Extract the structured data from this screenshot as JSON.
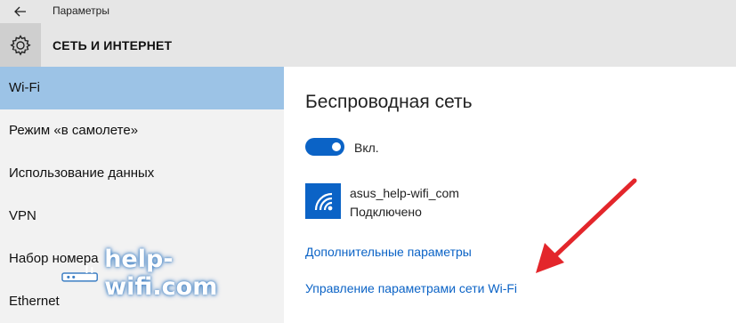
{
  "window": {
    "title": "Параметры"
  },
  "header": {
    "title": "СЕТЬ И ИНТЕРНЕТ"
  },
  "sidebar": {
    "items": [
      {
        "label": "Wi-Fi",
        "active": true
      },
      {
        "label": "Режим «в самолете»"
      },
      {
        "label": "Использование данных"
      },
      {
        "label": "VPN"
      },
      {
        "label": "Набор номера"
      },
      {
        "label": "Ethernet"
      }
    ]
  },
  "main": {
    "heading": "Беспроводная сеть",
    "toggle": {
      "label": "Вкл.",
      "state": "on"
    },
    "network": {
      "name": "asus_help-wifi_com",
      "status": "Подключено",
      "icon": "wifi-icon"
    },
    "links": {
      "advanced": "Дополнительные параметры",
      "manage": "Управление параметрами сети Wi-Fi"
    }
  },
  "watermark": {
    "text": "help-wifi.com"
  },
  "colors": {
    "accent": "#0b63c6",
    "sidebar_active": "#9cc3e6",
    "arrow": "#e3262b",
    "header_bg": "#e6e6e6"
  }
}
